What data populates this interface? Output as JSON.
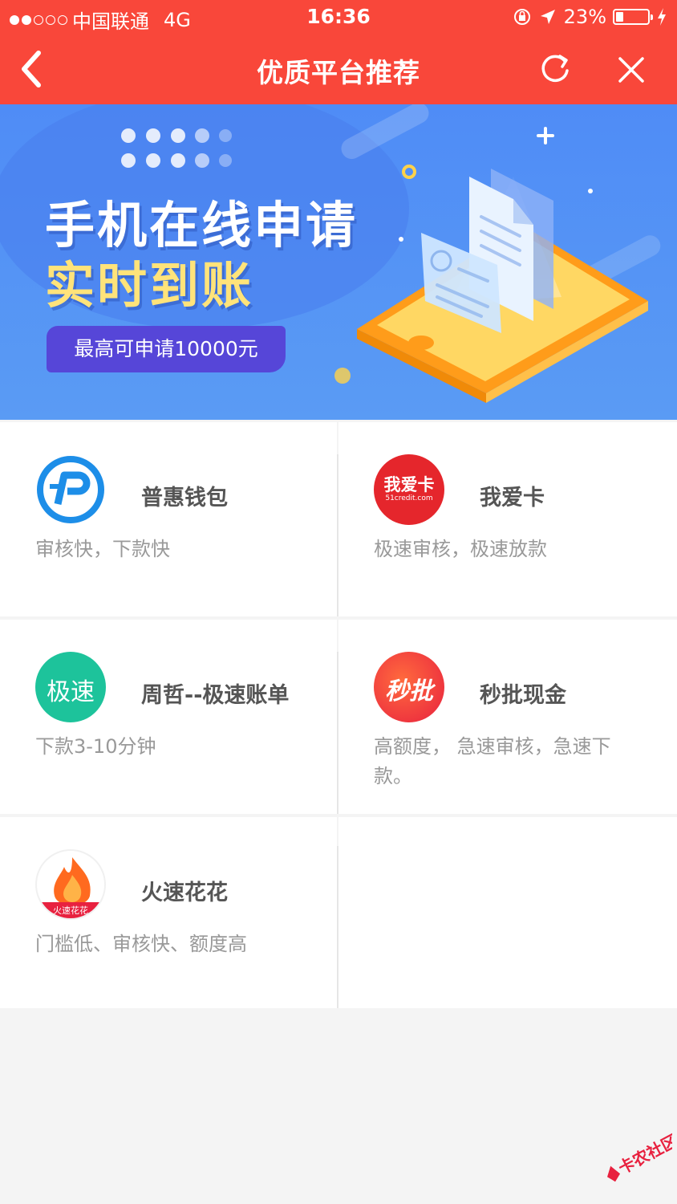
{
  "status_bar": {
    "carrier": "中国联通",
    "network": "4G",
    "time": "16:36",
    "battery": "23%",
    "battery_level": 0.23
  },
  "nav": {
    "title": "优质平台推荐",
    "back_icon": "chevron-left-icon",
    "refresh_icon": "refresh-icon",
    "close_icon": "close-icon"
  },
  "banner": {
    "headline": "手机在线申请",
    "subheadline": "实时到账",
    "pill": "最高可申请10000元"
  },
  "platforms": [
    {
      "name": "普惠钱包",
      "desc": "审核快，下款快",
      "icon_text": ""
    },
    {
      "name": "我爱卡",
      "desc": "极速审核，极速放款",
      "icon_text": "我爱卡",
      "icon_sub": "51credit.com"
    },
    {
      "name": "周哲--极速账单",
      "desc": "下款3-10分钟",
      "icon_text": "极速"
    },
    {
      "name": "秒批现金",
      "desc": "高额度， 急速审核，急速下款。",
      "icon_text": "秒批"
    },
    {
      "name": "火速花花",
      "desc": "门槛低、审核快、额度高",
      "icon_text": "火速花花"
    }
  ],
  "watermark": {
    "text": "卡农社区"
  },
  "colors": {
    "nav_bg": "#f9473a",
    "banner_bg": "#5090f5",
    "page_bg": "#f4f4f4"
  }
}
